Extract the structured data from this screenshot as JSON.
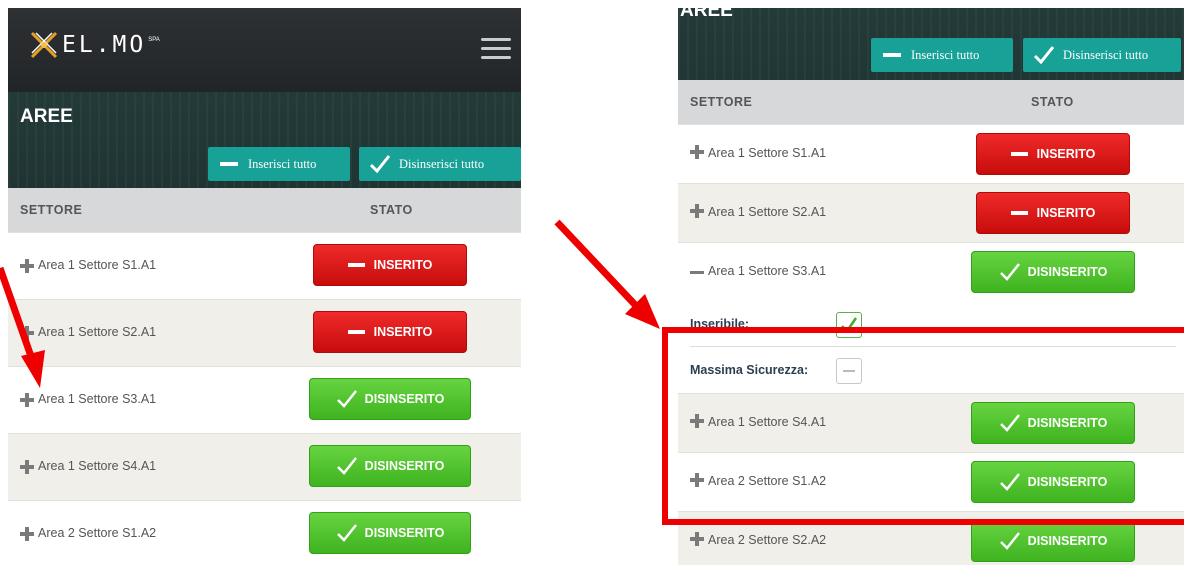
{
  "brand": {
    "logo_text": "EL.MO",
    "logo_suffix": "SPA"
  },
  "left": {
    "area_title": "AREE",
    "buttons": {
      "arm_all": "Inserisci tutto",
      "disarm_all": "Disinserisci tutto"
    },
    "table": {
      "col_sector": "SETTORE",
      "col_state": "STATO",
      "rows": [
        {
          "label": "Area 1 Settore S1.A1",
          "status": "INSERITO"
        },
        {
          "label": "Area 1 Settore S2.A1",
          "status": "INSERITO"
        },
        {
          "label": "Area 1 Settore S3.A1",
          "status": "DISINSERITO"
        },
        {
          "label": "Area 1 Settore S4.A1",
          "status": "DISINSERITO"
        },
        {
          "label": "Area 2 Settore S1.A2",
          "status": "DISINSERITO"
        }
      ]
    }
  },
  "right": {
    "area_title": "AREE",
    "buttons": {
      "arm_all": "Inserisci tutto",
      "disarm_all": "Disinserisci tutto"
    },
    "table": {
      "col_sector": "SETTORE",
      "col_state": "STATO",
      "rows": [
        {
          "label": "Area 1 Settore S1.A1",
          "status": "INSERITO"
        },
        {
          "label": "Area 1 Settore S2.A1",
          "status": "INSERITO"
        },
        {
          "label": "Area 1 Settore S3.A1",
          "status": "DISINSERITO"
        }
      ],
      "details": {
        "arming_label": "Inseribile:",
        "arming_checked": true,
        "max_security_label": "Massima Sicurezza:",
        "max_security_checked": false
      },
      "rows_after": [
        {
          "label": "Area 1 Settore S4.A1",
          "status": "DISINSERITO"
        },
        {
          "label": "Area 2 Settore S1.A2",
          "status": "DISINSERITO"
        },
        {
          "label": "Area 2 Settore S2.A2",
          "status": "DISINSERITO"
        }
      ]
    }
  },
  "colors": {
    "teal": "#17a197",
    "armed_red": "#e11c1c",
    "disarmed_green": "#4cc22c",
    "annotation_red": "#ee0000"
  },
  "icons": [
    "logo-icon",
    "menu-icon",
    "minus-icon",
    "check-icon",
    "plus-icon",
    "arrow-annotation"
  ]
}
